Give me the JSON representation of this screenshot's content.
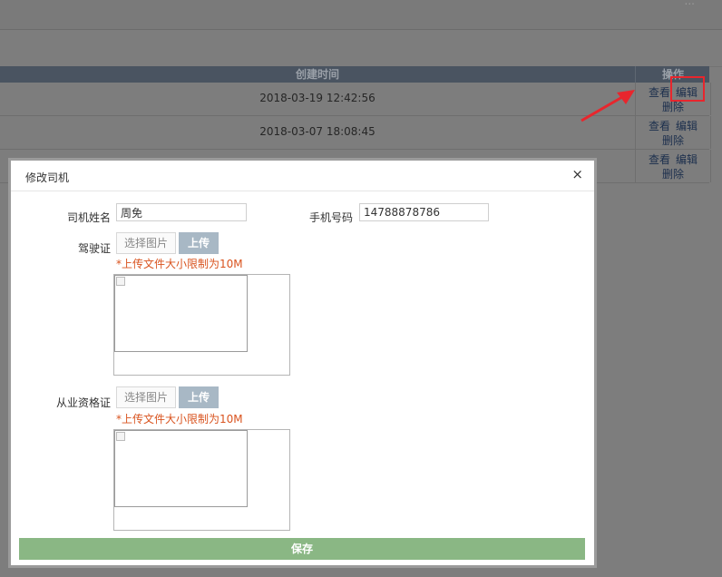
{
  "background": {
    "topbar_text": "...",
    "table": {
      "headers": [
        "创建时间",
        "操作"
      ],
      "rows": [
        {
          "time": "2018-03-19 12:42:56",
          "actions": [
            "查看",
            "编辑",
            "删除"
          ]
        },
        {
          "time": "2018-03-07 18:08:45",
          "actions": [
            "查看",
            "编辑",
            "删除"
          ]
        },
        {
          "time": "",
          "actions": [
            "查看",
            "编辑",
            "删除"
          ]
        }
      ]
    },
    "highlight_color": "#e8262d"
  },
  "modal": {
    "title": "修改司机",
    "close": "×",
    "driver_name_label": "司机姓名",
    "driver_name_value": "周免",
    "phone_label": "手机号码",
    "phone_value": "14788878786",
    "license_label": "驾驶证",
    "qualification_label": "从业资格证",
    "choose_image": "选择图片",
    "upload": "上传",
    "size_hint": "*上传文件大小限制为10M",
    "save": "保存",
    "save_color": "#8ab784",
    "hint_color": "#d9531e"
  }
}
